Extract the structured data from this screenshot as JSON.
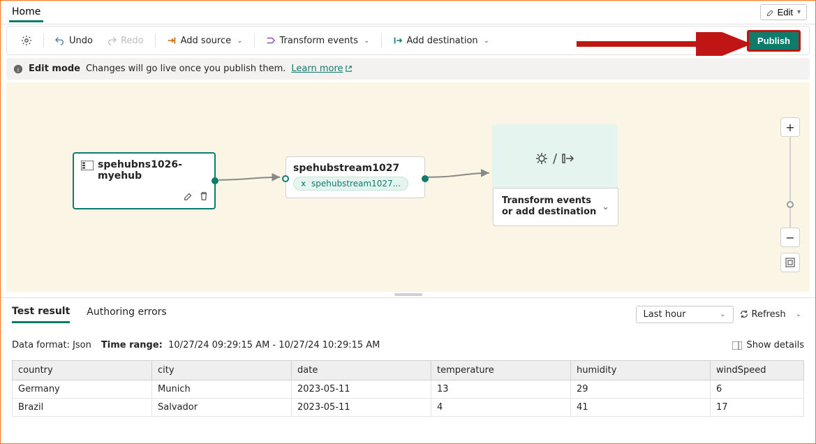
{
  "tabbar": {
    "home": "Home",
    "edit": "Edit"
  },
  "toolbar": {
    "undo": "Undo",
    "redo": "Redo",
    "add_source": "Add source",
    "transform": "Transform events",
    "add_dest": "Add destination",
    "publish": "Publish"
  },
  "banner": {
    "mode": "Edit mode",
    "msg": "Changes will go live once you publish them.",
    "link": "Learn more"
  },
  "nodes": {
    "source_title": "spehubns1026-myehub",
    "stream_title": "spehubstream1027",
    "stream_badge": "spehubstream1027...",
    "target_text": "Transform events or add destination"
  },
  "results": {
    "tab_result": "Test result",
    "tab_errors": "Authoring errors",
    "range_label": "Last hour",
    "refresh": "Refresh",
    "format_label": "Data format:",
    "format_value": "Json",
    "timerange_label": "Time range:",
    "timerange_value": "10/27/24 09:29:15 AM - 10/27/24 10:29:15 AM",
    "details": "Show details",
    "columns": [
      "country",
      "city",
      "date",
      "temperature",
      "humidity",
      "windSpeed"
    ],
    "rows": [
      {
        "c0": "Germany",
        "c1": "Munich",
        "c2": "2023-05-11",
        "c3": "13",
        "c4": "29",
        "c5": "6"
      },
      {
        "c0": "Brazil",
        "c1": "Salvador",
        "c2": "2023-05-11",
        "c3": "4",
        "c4": "41",
        "c5": "17"
      }
    ]
  }
}
